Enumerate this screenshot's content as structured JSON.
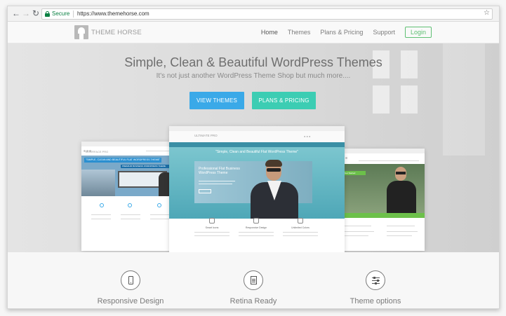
{
  "browser": {
    "secure_label": "Secure",
    "url": "https://www.themehorse.com",
    "back_icon": "arrow-left-icon",
    "forward_icon": "arrow-right-icon",
    "reload_icon": "reload-icon",
    "bookmark_icon": "star-icon"
  },
  "header": {
    "logo_text": "THEME HORSE",
    "menu": [
      {
        "label": "Home"
      },
      {
        "label": "Themes"
      },
      {
        "label": "Plans & Pricing"
      },
      {
        "label": "Support"
      },
      {
        "label": "Login"
      }
    ]
  },
  "hero": {
    "title": "Simple, Clean & Beautiful WordPress Themes",
    "subtitle": "It's not just another WordPress Theme Shop but much more....",
    "primary_button": "VIEW THEMES",
    "secondary_button": "PLANS & PRICING"
  },
  "mockups": {
    "left": {
      "name": "INTERFACE PRO",
      "tagline": "\"SIMPLE, CLEAN AND BEAUTIFUL FLAT WORDPRESS THEME\"",
      "sub": "PREMIUM BUSINESS WORDPRESS THEME"
    },
    "center": {
      "name": "ULTIMATE PRO",
      "tagline": "\"Simple, Clean and Beautiful Flat WordPress Theme\"",
      "panel_title": "Professional Flat Business WordPress Theme",
      "features": [
        "Smart Icons",
        "Responsive Design",
        "Unlimited Colors"
      ]
    },
    "right": {
      "name": "",
      "badge": "Get Started"
    }
  },
  "features": [
    {
      "label": "Responsive Design",
      "icon": "mobile-icon"
    },
    {
      "label": "Retina Ready",
      "icon": "document-icon"
    },
    {
      "label": "Theme options",
      "icon": "sliders-icon"
    }
  ],
  "colors": {
    "view_themes": "#3aa9e8",
    "plans_pricing": "#3ccdb3",
    "login_border": "#5fbf73",
    "secure": "#0b8043"
  }
}
